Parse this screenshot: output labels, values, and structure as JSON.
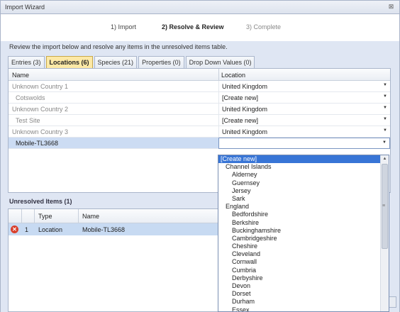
{
  "window": {
    "title": "Import Wizard",
    "close_glyph": "⊠"
  },
  "steps": [
    "1) Import",
    "2) Resolve & Review",
    "3) Complete"
  ],
  "instructions": "Review the import below and resolve any items in the unresolved items table.",
  "tabs": [
    {
      "label": "Entries (3)",
      "active": false
    },
    {
      "label": "Locations (6)",
      "active": true
    },
    {
      "label": "Species (21)",
      "active": false
    },
    {
      "label": "Properties (0)",
      "active": false
    },
    {
      "label": "Drop Down Values (0)",
      "active": false
    }
  ],
  "grid": {
    "headers": {
      "name": "Name",
      "location": "Location"
    },
    "rows": [
      {
        "name": "Unknown Country 1",
        "location": "United Kingdom"
      },
      {
        "name": "Cotswolds",
        "location": "[Create new]"
      },
      {
        "name": "Unknown Country 2",
        "location": "United Kingdom"
      },
      {
        "name": "Test Site",
        "location": "[Create new]"
      },
      {
        "name": "Unknown Country 3",
        "location": "United Kingdom"
      },
      {
        "name": "Mobile-TL3668",
        "location": ""
      }
    ]
  },
  "unresolved": {
    "title": "Unresolved Items (1)",
    "headers": {
      "type": "Type",
      "name": "Name"
    },
    "rows": [
      {
        "index": "1",
        "type": "Location",
        "name": "Mobile-TL3668",
        "error_glyph": "✕"
      }
    ]
  },
  "dropdown": {
    "items": [
      {
        "label": "[Create new]",
        "level": 0,
        "selected": true
      },
      {
        "label": "Channel Islands",
        "level": 1
      },
      {
        "label": "Alderney",
        "level": 2
      },
      {
        "label": "Guernsey",
        "level": 2
      },
      {
        "label": "Jersey",
        "level": 2
      },
      {
        "label": "Sark",
        "level": 2
      },
      {
        "label": "England",
        "level": 1
      },
      {
        "label": "Bedfordshire",
        "level": 2
      },
      {
        "label": "Berkshire",
        "level": 2
      },
      {
        "label": "Buckinghamshire",
        "level": 2
      },
      {
        "label": "Cambridgeshire",
        "level": 2
      },
      {
        "label": "Cheshire",
        "level": 2
      },
      {
        "label": "Cleveland",
        "level": 2
      },
      {
        "label": "Cornwall",
        "level": 2
      },
      {
        "label": "Cumbria",
        "level": 2
      },
      {
        "label": "Derbyshire",
        "level": 2
      },
      {
        "label": "Devon",
        "level": 2
      },
      {
        "label": "Dorset",
        "level": 2
      },
      {
        "label": "Durham",
        "level": 2
      },
      {
        "label": "Essex",
        "level": 2
      }
    ]
  },
  "icons": {
    "dropdown_arrow": "▼",
    "scroll_up": "▲",
    "scroll_grip": "≡"
  },
  "colors": {
    "selected_item": "#3875d6",
    "active_tab": "#fde9a6",
    "error": "#d9402c"
  }
}
